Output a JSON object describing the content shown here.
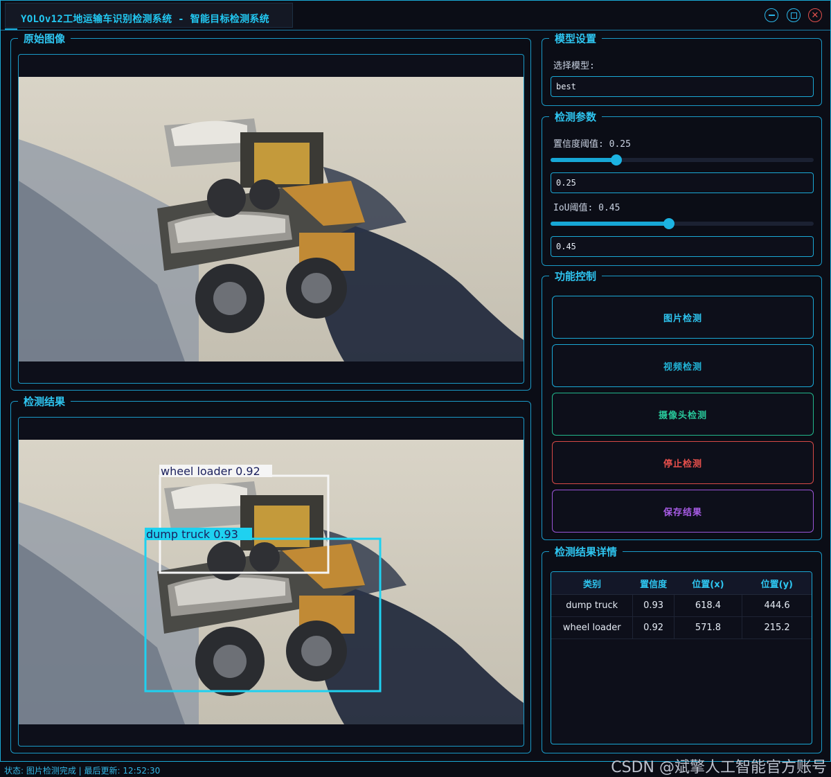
{
  "window": {
    "title": "YOLOv12工地运输车识别检测系统 - 智能目标检测系统",
    "controls": [
      "minimize",
      "maximize",
      "close"
    ]
  },
  "original_panel": {
    "title": "原始图像"
  },
  "result_panel": {
    "title": "检测结果",
    "detections": [
      {
        "label": "wheel loader 0.92",
        "color": "#ffffff"
      },
      {
        "label": "dump truck 0.93",
        "color": "#1fd1f0"
      }
    ]
  },
  "model_settings": {
    "title": "模型设置",
    "select_label": "选择模型:",
    "selected_model": "best"
  },
  "params": {
    "title": "检测参数",
    "conf_label": "置信度阈值: 0.25",
    "conf_value": "0.25",
    "conf_fraction": 0.25,
    "iou_label": "IoU阈值: 0.45",
    "iou_value": "0.45",
    "iou_fraction": 0.45
  },
  "controls": {
    "title": "功能控制",
    "buttons": [
      {
        "label": "图片检测",
        "color": "#2ec5f0"
      },
      {
        "label": "视频检测",
        "color": "#22b5d8"
      },
      {
        "label": "摄像头检测",
        "color": "#28c79a"
      },
      {
        "label": "停止检测",
        "color": "#e8504c"
      },
      {
        "label": "保存结果",
        "color": "#a85ce6"
      }
    ]
  },
  "details": {
    "title": "检测结果详情",
    "columns": [
      "类别",
      "置信度",
      "位置(x)",
      "位置(y)"
    ],
    "rows": [
      [
        "dump truck",
        "0.93",
        "618.4",
        "444.6"
      ],
      [
        "wheel loader",
        "0.92",
        "571.8",
        "215.2"
      ]
    ]
  },
  "status_bar": {
    "text": "状态: 图片检测完成 | 最后更新: 12:52:30"
  },
  "watermark": "CSDN @斌擎人工智能官方账号"
}
